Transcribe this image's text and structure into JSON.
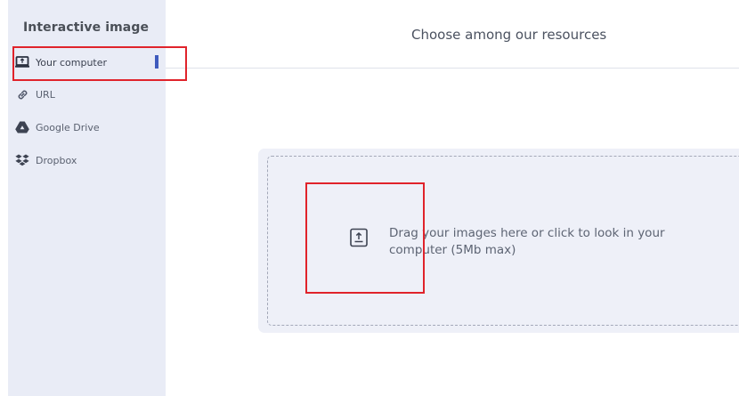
{
  "sidebar": {
    "title": "Interactive image",
    "items": [
      {
        "label": "Your computer",
        "icon": "computer-upload-icon",
        "active": true
      },
      {
        "label": "URL",
        "icon": "link-icon",
        "active": false
      },
      {
        "label": "Google Drive",
        "icon": "google-drive-icon",
        "active": false
      },
      {
        "label": "Dropbox",
        "icon": "dropbox-icon",
        "active": false
      }
    ]
  },
  "header": {
    "title": "Choose among our resources"
  },
  "dropzone": {
    "text": "Drag your images here or click to look in your computer (5Mb max)",
    "icon": "file-upload-icon"
  },
  "colors": {
    "sidebar_bg": "#e9ecf6",
    "accent": "#3f5bbd",
    "annotation": "#e0232b",
    "dropzone_bg": "#eef0f8"
  }
}
